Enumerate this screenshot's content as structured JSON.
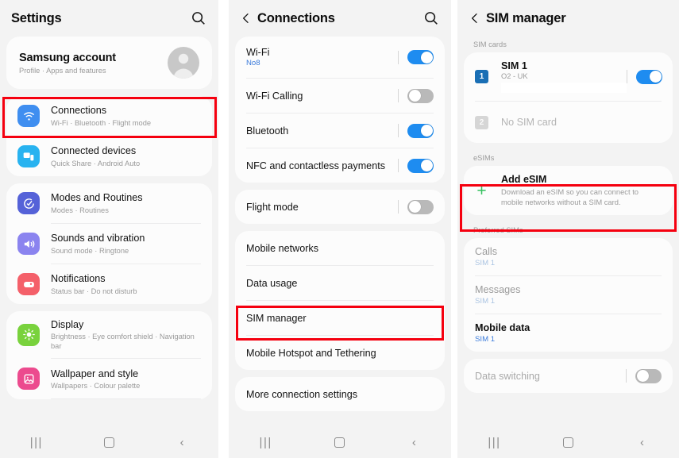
{
  "panels": {
    "settings": {
      "title": "Settings",
      "search_icon": "search-icon",
      "account": {
        "name": "Samsung account",
        "subtitle": "Profile · Apps and features",
        "avatar_icon": "person-avatar-icon"
      },
      "items": [
        {
          "label": "Connections",
          "subtitle": "Wi-Fi · Bluetooth · Flight mode",
          "icon": "wifi-icon",
          "color": "#3f8ef0",
          "highlighted": true
        },
        {
          "label": "Connected devices",
          "subtitle": "Quick Share · Android Auto",
          "icon": "devices-icon",
          "color": "#28b3f0",
          "highlighted": false
        },
        {
          "label": "Modes and Routines",
          "subtitle": "Modes · Routines",
          "icon": "modes-icon",
          "color": "#5562d8",
          "highlighted": false
        },
        {
          "label": "Sounds and vibration",
          "subtitle": "Sound mode · Ringtone",
          "icon": "speaker-icon",
          "color": "#8b84ef",
          "highlighted": false
        },
        {
          "label": "Notifications",
          "subtitle": "Status bar · Do not disturb",
          "icon": "notification-icon",
          "color": "#f4606a",
          "highlighted": false
        },
        {
          "label": "Display",
          "subtitle": "Brightness · Eye comfort shield · Navigation bar",
          "icon": "brightness-icon",
          "color": "#79d23d",
          "highlighted": false
        },
        {
          "label": "Wallpaper and style",
          "subtitle": "Wallpapers · Colour palette",
          "icon": "wallpaper-icon",
          "color": "#ec4b8e",
          "highlighted": false
        }
      ]
    },
    "connections": {
      "title": "Connections",
      "back_icon": "chevron-left-icon",
      "search_icon": "search-icon",
      "toggles": [
        {
          "label": "Wi-Fi",
          "value": "No8",
          "state": "on"
        },
        {
          "label": "Wi-Fi Calling",
          "value": "",
          "state": "off"
        },
        {
          "label": "Bluetooth",
          "value": "",
          "state": "on"
        },
        {
          "label": "NFC and contactless payments",
          "value": "",
          "state": "on"
        }
      ],
      "flight_mode": {
        "label": "Flight mode",
        "state": "off"
      },
      "links": [
        {
          "label": "Mobile networks",
          "highlighted": false
        },
        {
          "label": "Data usage",
          "highlighted": false
        },
        {
          "label": "SIM manager",
          "highlighted": true
        },
        {
          "label": "Mobile Hotspot and Tethering",
          "highlighted": false
        }
      ],
      "more": {
        "label": "More connection settings"
      }
    },
    "sim": {
      "title": "SIM manager",
      "back_icon": "chevron-left-icon",
      "sections": {
        "sim_cards_label": "SIM cards",
        "esims_label": "eSIMs",
        "preferred_label": "Preferred SIMs"
      },
      "sim_cards": [
        {
          "badge": "1",
          "label": "SIM 1",
          "carrier": "O2 - UK",
          "state": "on",
          "redacted": true
        },
        {
          "badge": "2",
          "label": "No SIM card",
          "carrier": "",
          "state": "absent",
          "redacted": false
        }
      ],
      "add_esim": {
        "label": "Add eSIM",
        "description": "Download an eSIM so you can connect to mobile networks without a SIM card.",
        "icon": "plus-icon",
        "highlighted": true
      },
      "preferred": [
        {
          "label": "Calls",
          "value": "SIM 1",
          "active": false
        },
        {
          "label": "Messages",
          "value": "SIM 1",
          "active": false
        },
        {
          "label": "Mobile data",
          "value": "SIM 1",
          "active": true
        }
      ],
      "data_switching": {
        "label": "Data switching",
        "state": "off"
      }
    }
  },
  "navbar": {
    "recents": "|||",
    "home": "home-square-icon",
    "back": "‹"
  },
  "colors": {
    "highlight": "#f5000f",
    "toggle_on": "#1e8cf0",
    "toggle_off": "#b9b9b9",
    "link_blue": "#3b7bdb",
    "panel_bg": "#f3f3f3",
    "card_bg": "#fcfcfc"
  }
}
